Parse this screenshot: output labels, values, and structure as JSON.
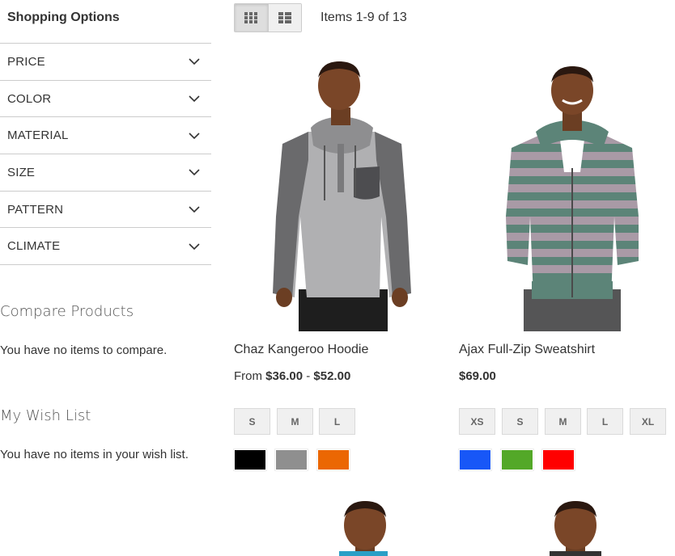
{
  "sidebar": {
    "title": "Shopping Options",
    "filters": [
      {
        "label": "PRICE"
      },
      {
        "label": "COLOR"
      },
      {
        "label": "MATERIAL"
      },
      {
        "label": "SIZE"
      },
      {
        "label": "PATTERN"
      },
      {
        "label": "CLIMATE"
      }
    ],
    "compare": {
      "title": "Compare Products",
      "empty": "You have no items to compare."
    },
    "wishlist": {
      "title": "My Wish List",
      "empty": "You have no items in your wish list."
    }
  },
  "toolbar": {
    "modes": [
      {
        "name": "grid-icon",
        "active": true
      },
      {
        "name": "list-icon",
        "active": false
      }
    ],
    "amount": "Items 1-9 of 13"
  },
  "products": [
    {
      "name": "Chaz Kangeroo Hoodie",
      "price_prefix": "From",
      "price_from": "$36.00",
      "price_sep": "-",
      "price_to": "$52.00",
      "sizes": [
        "S",
        "M",
        "L"
      ],
      "colors": [
        "#000000",
        "#8f8f8f",
        "#eb6703"
      ]
    },
    {
      "name": "Ajax Full-Zip Sweatshirt",
      "price": "$69.00",
      "sizes": [
        "XS",
        "S",
        "M",
        "L",
        "XL"
      ],
      "colors": [
        "#1857f7",
        "#53a828",
        "#ff0000"
      ]
    }
  ]
}
